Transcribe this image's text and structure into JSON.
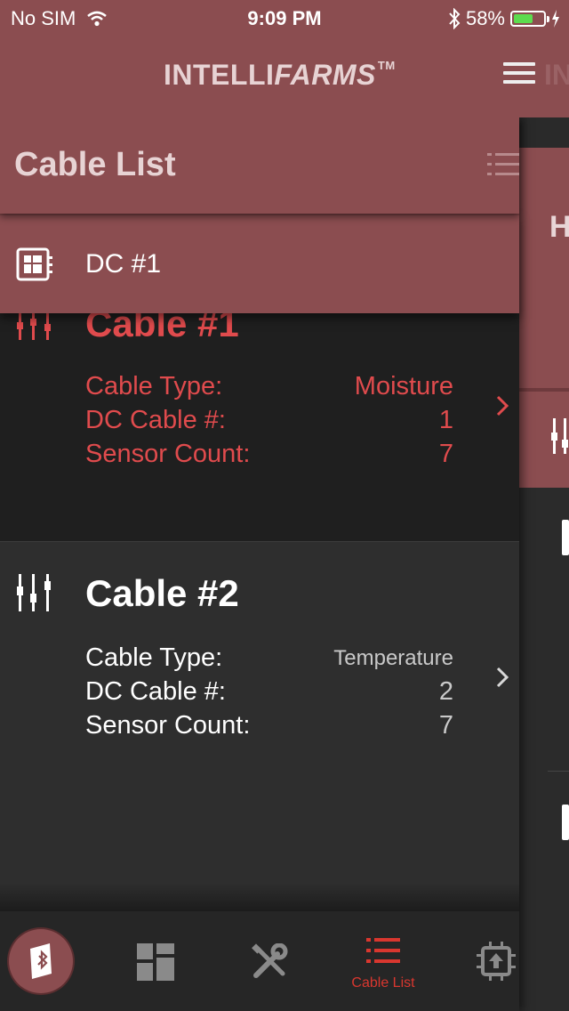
{
  "status_bar": {
    "carrier": "No SIM",
    "time": "9:09 PM",
    "battery_percent": "58%",
    "battery_level": 0.58
  },
  "header": {
    "brand_plain": "INTELLI",
    "brand_italic": "FARMS",
    "brand_tm": "TM"
  },
  "list_panel": {
    "title": "Cable List",
    "dc_label": "DC #1"
  },
  "cables": [
    {
      "name": "Cable #1",
      "type_label": "Cable Type:",
      "type_value": "Moisture",
      "dc_cable_label": "DC Cable #:",
      "dc_cable_value": "1",
      "sensor_label": "Sensor Count:",
      "sensor_value": "7"
    },
    {
      "name": "Cable #2",
      "type_label": "Cable Type:",
      "type_value": "Temperature",
      "dc_cable_label": "DC Cable #:",
      "dc_cable_value": "2",
      "sensor_label": "Sensor Count:",
      "sensor_value": "7"
    }
  ],
  "back_panel": {
    "heading_fragment": "H"
  },
  "tabs": {
    "cable_list_label": "Cable List"
  },
  "colors": {
    "brand": "#8b4d50",
    "accent_red": "#e04b4d",
    "tab_active": "#d9372f"
  },
  "icons": [
    "wifi-icon",
    "bluetooth-icon",
    "charging-icon",
    "menu-icon",
    "list-icon",
    "controller-icon",
    "slider-icon",
    "chevron-right-icon",
    "dashboard-icon",
    "tools-icon",
    "chip-icon"
  ]
}
